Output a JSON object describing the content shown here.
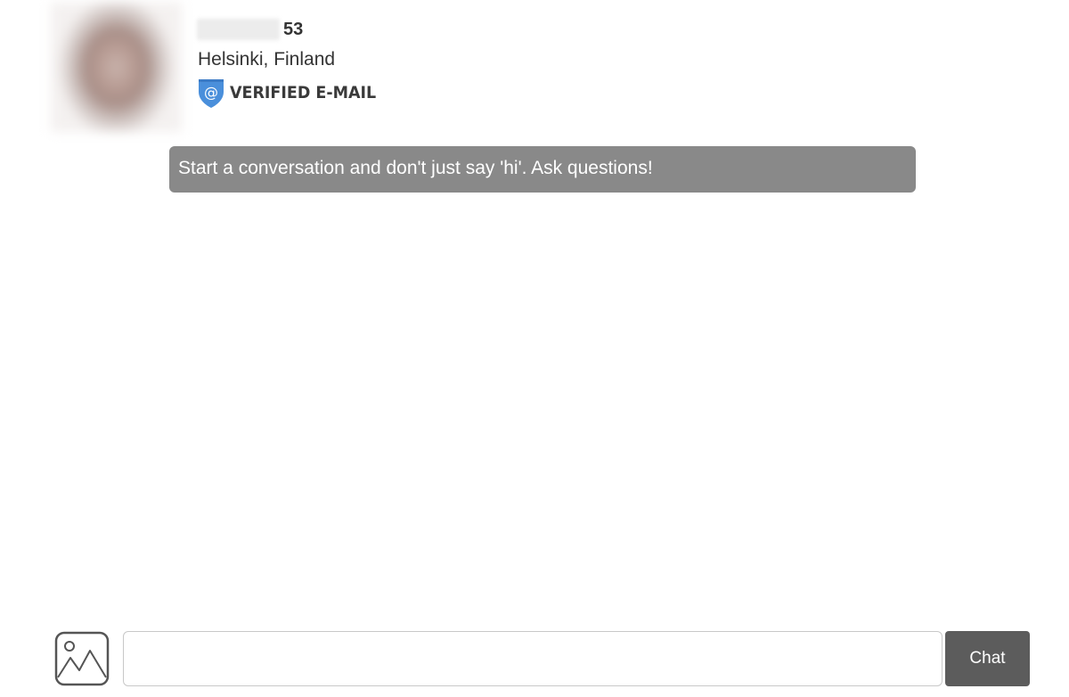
{
  "profile": {
    "age": "53",
    "location": "Helsinki, Finland",
    "verified_label": "VERIFIED E-MAIL",
    "verified_icon": "at-shield-icon",
    "badge_color": "#4a8fdb"
  },
  "chat": {
    "hint": "Start a conversation and don't just say 'hi'. Ask questions!",
    "input_value": "",
    "send_label": "Chat",
    "attach_icon": "image-icon"
  },
  "colors": {
    "hint_bg": "#898989",
    "send_bg": "#5c5c5c"
  }
}
